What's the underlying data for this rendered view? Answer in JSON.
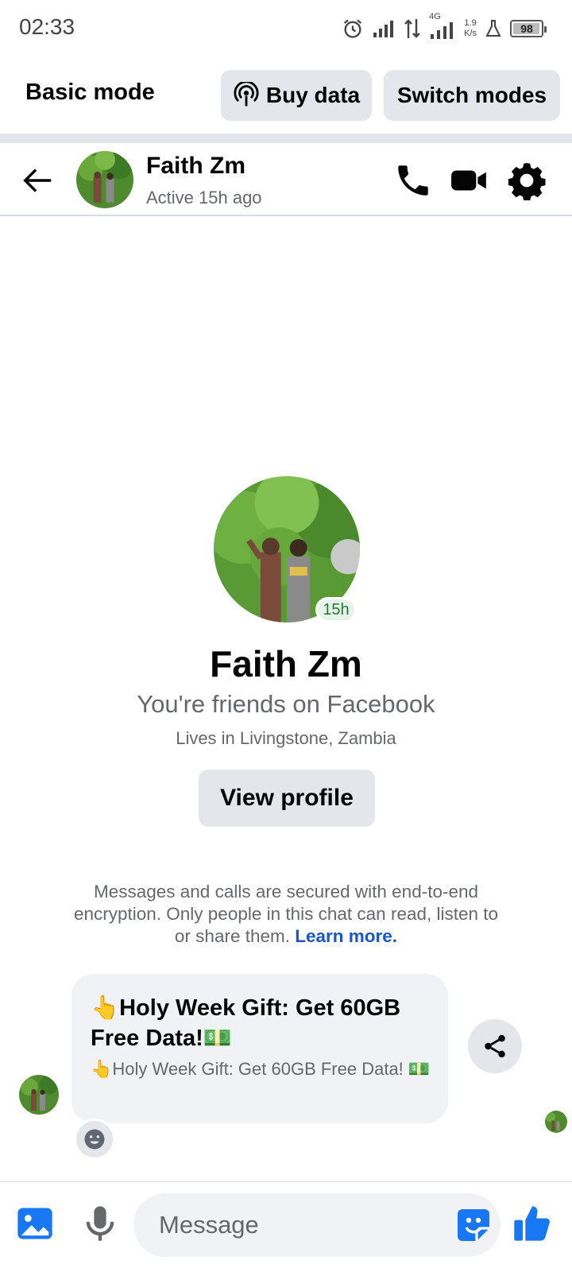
{
  "status_bar": {
    "time": "02:33",
    "network_type": "4G",
    "net_speed_value": "1.9",
    "net_speed_unit": "K/s",
    "battery_percent": 98
  },
  "mode_bar": {
    "label": "Basic mode",
    "buy_data": "Buy data",
    "switch_modes": "Switch modes"
  },
  "chat_header": {
    "name": "Faith Zm",
    "status": "Active 15h ago"
  },
  "profile": {
    "active_badge": "15h",
    "name": "Faith Zm",
    "friends_text": "You're friends on Facebook",
    "location": "Lives in Livingstone, Zambia",
    "view_profile": "View profile"
  },
  "encryption": {
    "text": "Messages and calls are secured with end-to-end encryption. Only people in this chat can read, listen to or share them.",
    "link": "Learn more."
  },
  "message": {
    "title": "👆Holy Week Gift: Get 60GB Free Data!💵",
    "subtitle": "👆Holy Week Gift: Get 60GB Free Data! 💵"
  },
  "composer": {
    "placeholder": "Message"
  },
  "colors": {
    "accent": "#1877f2",
    "link": "#1a56c8",
    "button_bg": "#e4e6eb",
    "bubble_bg": "#f0f2f5",
    "secondary_text": "#65676b"
  }
}
